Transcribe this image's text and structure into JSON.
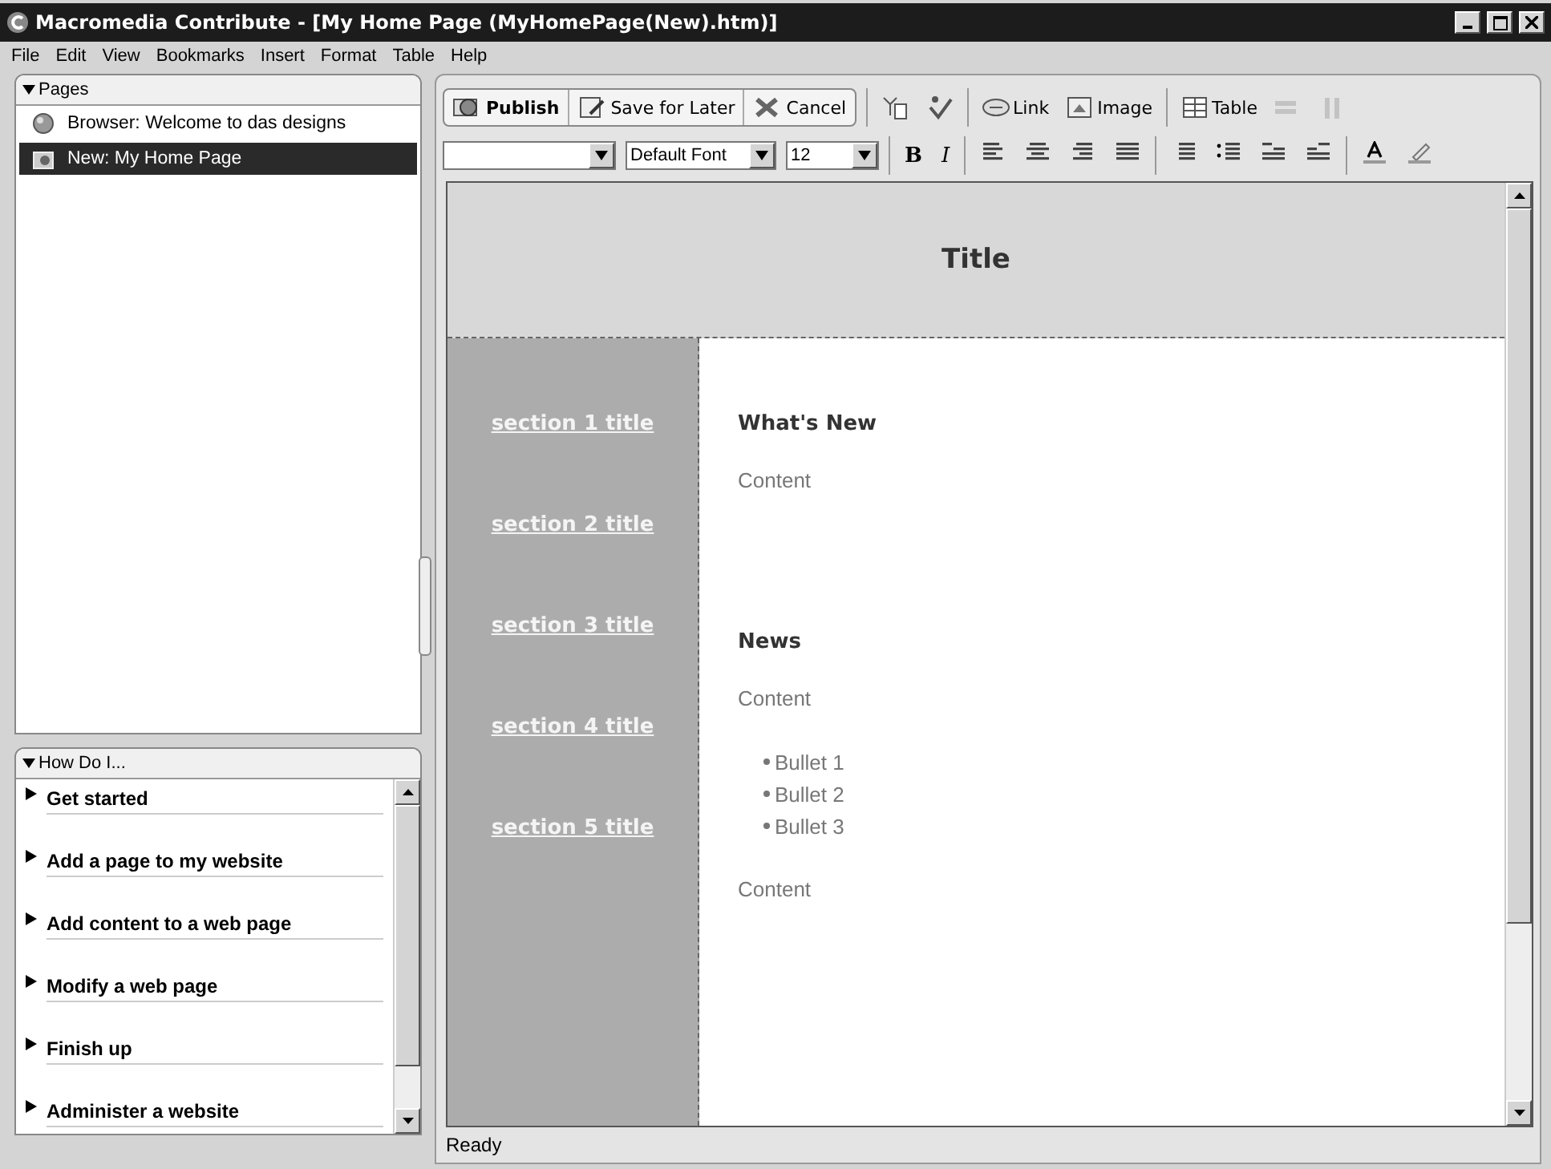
{
  "window": {
    "title": "Macromedia Contribute - [My Home Page (MyHomePage(New).htm)]"
  },
  "menu": [
    "File",
    "Edit",
    "View",
    "Bookmarks",
    "Insert",
    "Format",
    "Table",
    "Help"
  ],
  "pages_panel": {
    "title": "Pages",
    "expanded": true,
    "items": [
      {
        "label": "Browser: Welcome to das designs",
        "kind": "browser",
        "selected": false
      },
      {
        "label": "New: My Home Page",
        "kind": "new",
        "selected": true
      }
    ]
  },
  "howto_panel": {
    "title": "How Do I...",
    "expanded": true,
    "items": [
      "Get started",
      "Add a page to my website",
      "Add content to a web page",
      "Modify a web page",
      "Finish up",
      "Administer a website"
    ]
  },
  "toolbar": [
    {
      "kind": "publish",
      "label": "Publish"
    },
    {
      "kind": "save",
      "label": "Save for Later"
    },
    {
      "kind": "cancel",
      "label": "Cancel"
    },
    {
      "kind": "sep"
    },
    {
      "kind": "pageprops"
    },
    {
      "kind": "spell"
    },
    {
      "kind": "sep"
    },
    {
      "kind": "link",
      "label": "Link"
    },
    {
      "kind": "image",
      "label": "Image"
    },
    {
      "kind": "sep"
    },
    {
      "kind": "table",
      "label": "Table",
      "disabled": false
    },
    {
      "kind": "rows",
      "disabled": true
    },
    {
      "kind": "cols",
      "disabled": true
    }
  ],
  "format_bar": {
    "font": "Default Font",
    "size": "12",
    "bold": "B",
    "italic": "I"
  },
  "document": {
    "title": "Title",
    "nav": [
      "section 1 title",
      "section 2 title",
      "section 3 title",
      "section 4 title",
      "section 5 title"
    ],
    "blocks": [
      {
        "kind": "heading",
        "text": "What's New"
      },
      {
        "kind": "para",
        "text": "Content"
      },
      {
        "kind": "spacer"
      },
      {
        "kind": "heading",
        "text": "News"
      },
      {
        "kind": "para",
        "text": "Content"
      },
      {
        "kind": "bullets",
        "items": [
          "Bullet 1",
          "Bullet 2",
          "Bullet 3"
        ]
      },
      {
        "kind": "para",
        "text": "Content"
      }
    ]
  },
  "status_bar": "Ready"
}
